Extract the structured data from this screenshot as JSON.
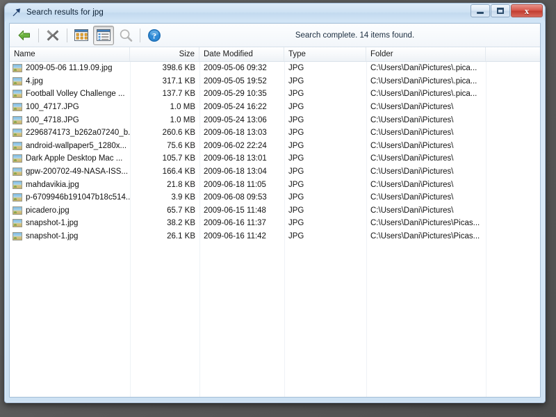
{
  "window": {
    "title": "Search results for jpg",
    "title_icon": "search-results-arrow-icon",
    "controls": {
      "minimize_label": "–",
      "maximize_label": "□",
      "close_label": "x"
    }
  },
  "toolbar": {
    "buttons": [
      {
        "name": "back-button",
        "icon": "green-back-arrow-icon",
        "pressed": false,
        "enabled": true
      },
      {
        "name": "stop-button",
        "icon": "gray-x-stop-icon",
        "pressed": false,
        "enabled": true
      },
      {
        "name": "thumbnails-view-button",
        "icon": "thumbnails-view-icon",
        "pressed": false,
        "enabled": true
      },
      {
        "name": "list-view-button",
        "icon": "list-view-icon",
        "pressed": true,
        "enabled": true
      },
      {
        "name": "search-button",
        "icon": "magnifier-search-icon",
        "pressed": false,
        "enabled": false
      },
      {
        "name": "help-button",
        "icon": "blue-question-help-icon",
        "pressed": false,
        "enabled": true
      }
    ],
    "status": "Search complete. 14 items found."
  },
  "columns": [
    {
      "key": "name",
      "label": "Name",
      "align": "left"
    },
    {
      "key": "size",
      "label": "Size",
      "align": "right"
    },
    {
      "key": "date",
      "label": "Date Modified",
      "align": "left"
    },
    {
      "key": "type",
      "label": "Type",
      "align": "left"
    },
    {
      "key": "folder",
      "label": "Folder",
      "align": "left"
    },
    {
      "key": "extra",
      "label": "",
      "align": "left"
    }
  ],
  "files": [
    {
      "name": "2009-05-06 11.19.09.jpg",
      "size": "398.6 KB",
      "date": "2009-05-06 09:32",
      "type": "JPG",
      "folder": "C:\\Users\\Dani\\Pictures\\.pica..."
    },
    {
      "name": "4.jpg",
      "size": "317.1 KB",
      "date": "2009-05-05 19:52",
      "type": "JPG",
      "folder": "C:\\Users\\Dani\\Pictures\\.pica..."
    },
    {
      "name": "Football Volley Challenge ...",
      "size": "137.7 KB",
      "date": "2009-05-29 10:35",
      "type": "JPG",
      "folder": "C:\\Users\\Dani\\Pictures\\.pica..."
    },
    {
      "name": "100_4717.JPG",
      "size": "1.0 MB",
      "date": "2009-05-24 16:22",
      "type": "JPG",
      "folder": "C:\\Users\\Dani\\Pictures\\"
    },
    {
      "name": "100_4718.JPG",
      "size": "1.0 MB",
      "date": "2009-05-24 13:06",
      "type": "JPG",
      "folder": "C:\\Users\\Dani\\Pictures\\"
    },
    {
      "name": "2296874173_b262a07240_b...",
      "size": "260.6 KB",
      "date": "2009-06-18 13:03",
      "type": "JPG",
      "folder": "C:\\Users\\Dani\\Pictures\\"
    },
    {
      "name": "android-wallpaper5_1280x...",
      "size": "75.6 KB",
      "date": "2009-06-02 22:24",
      "type": "JPG",
      "folder": "C:\\Users\\Dani\\Pictures\\"
    },
    {
      "name": "Dark Apple Desktop Mac ...",
      "size": "105.7 KB",
      "date": "2009-06-18 13:01",
      "type": "JPG",
      "folder": "C:\\Users\\Dani\\Pictures\\"
    },
    {
      "name": "gpw-200702-49-NASA-ISS...",
      "size": "166.4 KB",
      "date": "2009-06-18 13:04",
      "type": "JPG",
      "folder": "C:\\Users\\Dani\\Pictures\\"
    },
    {
      "name": "mahdavikia.jpg",
      "size": "21.8 KB",
      "date": "2009-06-18 11:05",
      "type": "JPG",
      "folder": "C:\\Users\\Dani\\Pictures\\"
    },
    {
      "name": "p-6709946b191047b18c514...",
      "size": "3.9 KB",
      "date": "2009-06-08 09:53",
      "type": "JPG",
      "folder": "C:\\Users\\Dani\\Pictures\\"
    },
    {
      "name": "picadero.jpg",
      "size": "65.7 KB",
      "date": "2009-06-15 11:48",
      "type": "JPG",
      "folder": "C:\\Users\\Dani\\Pictures\\"
    },
    {
      "name": "snapshot-1.jpg",
      "size": "38.2 KB",
      "date": "2009-06-16 11:37",
      "type": "JPG",
      "folder": "C:\\Users\\Dani\\Pictures\\Picas..."
    },
    {
      "name": "snapshot-1.jpg",
      "size": "26.1 KB",
      "date": "2009-06-16 11:42",
      "type": "JPG",
      "folder": "C:\\Users\\Dani\\Pictures\\Picas..."
    }
  ],
  "colors": {
    "desktop": "#5d5d5d",
    "frame_glass": "#cfe3f5",
    "client_bg": "#ffffff",
    "close_button": "#c03c30",
    "back_arrow_green": "#5aa22e",
    "help_blue": "#1f6fb5"
  }
}
